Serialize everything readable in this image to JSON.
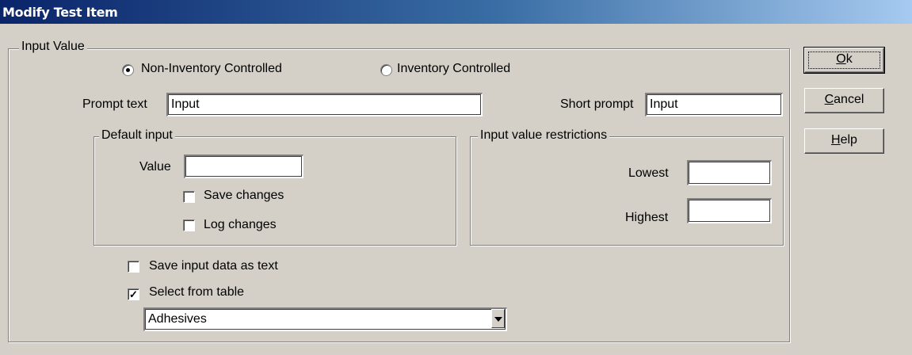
{
  "window": {
    "title": "Modify Test Item"
  },
  "input_value_group": {
    "legend": "Input Value"
  },
  "control_type": {
    "non_inventory_label": "Non-Inventory Controlled",
    "inventory_label": "Inventory Controlled",
    "selected": "non_inventory"
  },
  "prompt_text": {
    "label": "Prompt text",
    "value": "Input"
  },
  "short_prompt": {
    "label": "Short prompt",
    "value": "Input"
  },
  "default_input": {
    "legend": "Default input",
    "value_label": "Value",
    "value": "",
    "save_changes_label": "Save changes",
    "save_changes_checked": false,
    "log_changes_label": "Log changes",
    "log_changes_checked": false
  },
  "restrictions": {
    "legend": "Input value restrictions",
    "lowest_label": "Lowest",
    "lowest_value": "",
    "highest_label": "Highest",
    "highest_value": ""
  },
  "options": {
    "save_as_text_label": "Save input data as text",
    "save_as_text_checked": false,
    "select_from_table_label": "Select from table",
    "select_from_table_checked": true,
    "table_selected": "Adhesives"
  },
  "buttons": {
    "ok_accel": "O",
    "ok_rest": "k",
    "cancel_accel": "C",
    "cancel_rest": "ancel",
    "help_accel": "H",
    "help_rest": "elp"
  }
}
